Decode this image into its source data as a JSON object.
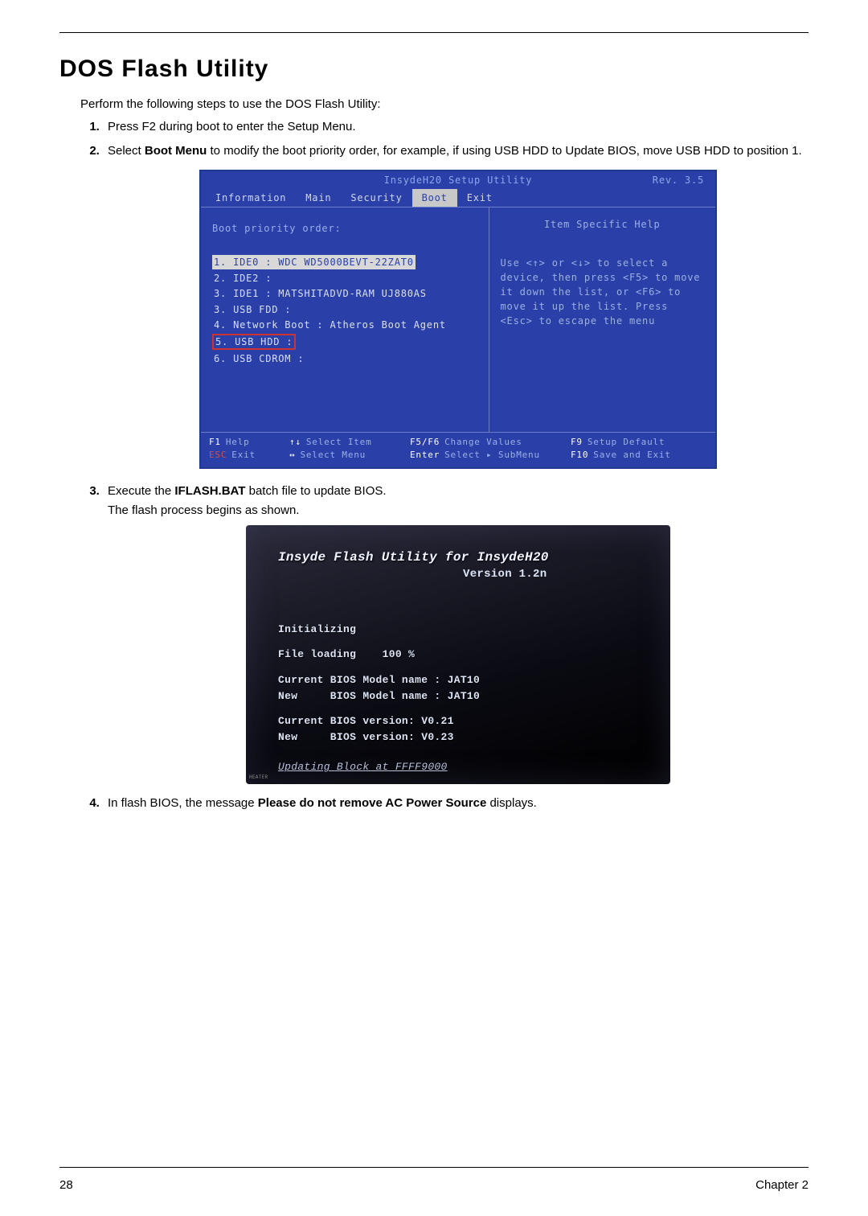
{
  "title": "DOS Flash Utility",
  "intro": "Perform the following steps to use the DOS Flash Utility:",
  "steps": {
    "s1": "Press F2 during boot to enter the Setup Menu.",
    "s2_a": "Select ",
    "s2_bold": "Boot Menu",
    "s2_b": " to modify the boot priority order, for example, if using USB HDD to Update BIOS, move USB HDD to position 1.",
    "s3_a": "Execute the ",
    "s3_bold": "IFLASH.BAT",
    "s3_b": " batch file to update BIOS.",
    "s3_sub": "The flash process begins as shown.",
    "s4_a": "In flash BIOS, the message ",
    "s4_bold": "Please do not remove AC Power Source",
    "s4_b": " displays."
  },
  "bios": {
    "title": "InsydeH20 Setup Utility",
    "rev": "Rev. 3.5",
    "tabs": [
      "Information",
      "Main",
      "Security",
      "Boot",
      "Exit"
    ],
    "active_tab": "Boot",
    "left_heading": "Boot priority order:",
    "boot_items": [
      "1. IDE0 : WDC WD5000BEVT-22ZAT0",
      "2. IDE2 :",
      "3. IDE1 : MATSHITADVD-RAM UJ880AS",
      "3. USB FDD :",
      "4. Network Boot : Atheros Boot Agent",
      "5. USB HDD :",
      "6. USB CDROM :"
    ],
    "help_title": "Item Specific Help",
    "help_body": "Use <↑> or <↓> to select a device, then press <F5> to move it down the list, or <F6> to move it up the list. Press <Esc> to escape the menu",
    "footer": {
      "r1": {
        "k1": "F1",
        "v1": "Help",
        "k2": "↑↓",
        "v2": "Select Item",
        "k3": "F5/F6",
        "v3": "Change Values",
        "k4": "F9",
        "v4": "Setup Default"
      },
      "r2": {
        "k1": "ESC",
        "v1": "Exit",
        "k2": "↔",
        "v2": "Select Menu",
        "k3": "Enter",
        "v3": "Select ▸ SubMenu",
        "k4": "F10",
        "v4": "Save and Exit"
      }
    }
  },
  "flash": {
    "title": "Insyde Flash Utility for InsydeH20",
    "version": "Version 1.2n",
    "l1": "Initializing",
    "l2": "File loading    100 %",
    "l3": "Current BIOS Model name : JAT10",
    "l4": "New     BIOS Model name : JAT10",
    "l5": "Current BIOS version: V0.21",
    "l6": "New     BIOS version: V0.23",
    "status": "Updating Block at FFFF9000",
    "corner": "HEATER"
  },
  "footer": {
    "page": "28",
    "chapter": "Chapter 2"
  }
}
